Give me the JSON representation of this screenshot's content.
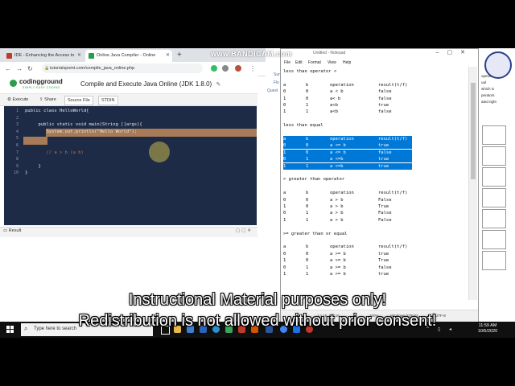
{
  "browser": {
    "tabs": [
      {
        "label": "IDE - Enhancing the Access to"
      },
      {
        "label": "Online Java Compiler - Online"
      }
    ],
    "url": "tutorialspoint.com/compile_java_online.php"
  },
  "coding_ground": {
    "logo": "codingground",
    "tagline": "SIMPLY EASY CODING",
    "title": "Compile and Execute Java Online (JDK 1.8.0)",
    "toolbar": {
      "execute": "Execute",
      "share": "Share",
      "source_file": "Source File",
      "stdin": "STDIN"
    },
    "code_lines": [
      {
        "n": "1",
        "text": "public class HelloWorld{"
      },
      {
        "n": "2",
        "text": ""
      },
      {
        "n": "3",
        "text": "     public static void main(String []args){"
      },
      {
        "n": "4",
        "text": "        System.out.println(\"Hello World\");"
      },
      {
        "n": "5",
        "text": ""
      },
      {
        "n": "6",
        "text": ""
      },
      {
        "n": "7",
        "text": "        // a > b (a b)"
      },
      {
        "n": "8",
        "text": ""
      },
      {
        "n": "9",
        "text": "     }"
      },
      {
        "n": "10",
        "text": "}"
      }
    ],
    "result_label": "Result"
  },
  "notepad": {
    "title": "Untitled - Notepad",
    "menu": [
      "File",
      "Edit",
      "Format",
      "View",
      "Help"
    ],
    "status": {
      "pos": "Ln 15, Col 16",
      "zoom": "100%",
      "eol": "Windows (CRLF)",
      "enc": "UTF-8"
    },
    "sections": [
      {
        "heading": "less than operator <",
        "rows": [
          [
            "a",
            "b",
            "operation",
            "result(t/f)"
          ],
          [
            "0",
            "0",
            "a < b",
            "false"
          ],
          [
            "1",
            "0",
            "a< b",
            "false"
          ],
          [
            "0",
            "1",
            "a<b",
            "true"
          ],
          [
            "1",
            "1",
            "a<b",
            "false"
          ]
        ]
      },
      {
        "heading": "less than equal",
        "rows": [
          [
            "a",
            "b",
            "operation",
            "result(t/f)"
          ],
          [
            "0",
            "0",
            "a <= b",
            "true"
          ],
          [
            "1",
            "0",
            "a <= b",
            "false"
          ],
          [
            "0",
            "1",
            "a <=b",
            "true"
          ],
          [
            "1",
            "1",
            "a <=b",
            "true"
          ]
        ]
      },
      {
        "heading": "> greater than operator",
        "rows": [
          [
            "a",
            "b",
            "operation",
            "result(t/f)"
          ],
          [
            "0",
            "0",
            "a > b",
            "False"
          ],
          [
            "1",
            "0",
            "a > b",
            "True"
          ],
          [
            "0",
            "1",
            "a > b",
            "False"
          ],
          [
            "1",
            "1",
            "a > b",
            "False"
          ]
        ]
      },
      {
        "heading": ">= greater than or equal",
        "rows": [
          [
            "a",
            "b",
            "operation",
            "result(t/f)"
          ],
          [
            "0",
            "0",
            "a >= b",
            "true"
          ],
          [
            "1",
            "0",
            "a >= b",
            "True"
          ],
          [
            "0",
            "1",
            "a >= b",
            "false"
          ],
          [
            "1",
            "1",
            "a >= b",
            "true"
          ]
        ]
      }
    ]
  },
  "background_window": {
    "left_peek": [
      "Sum",
      "Flo",
      "Quest"
    ],
    "right_peek": [
      "operato",
      "ual",
      "which is",
      "perators",
      "ated right"
    ]
  },
  "taskbar": {
    "search_placeholder": "Type here to search",
    "time": "11:59 AM",
    "date": "10/5/2020"
  },
  "overlay": {
    "watermark": "www.BANDICAM.com",
    "caption_line1": "Instructional Material purposes only!",
    "caption_line2": "Redistribution is not allowed without prior consent!"
  }
}
